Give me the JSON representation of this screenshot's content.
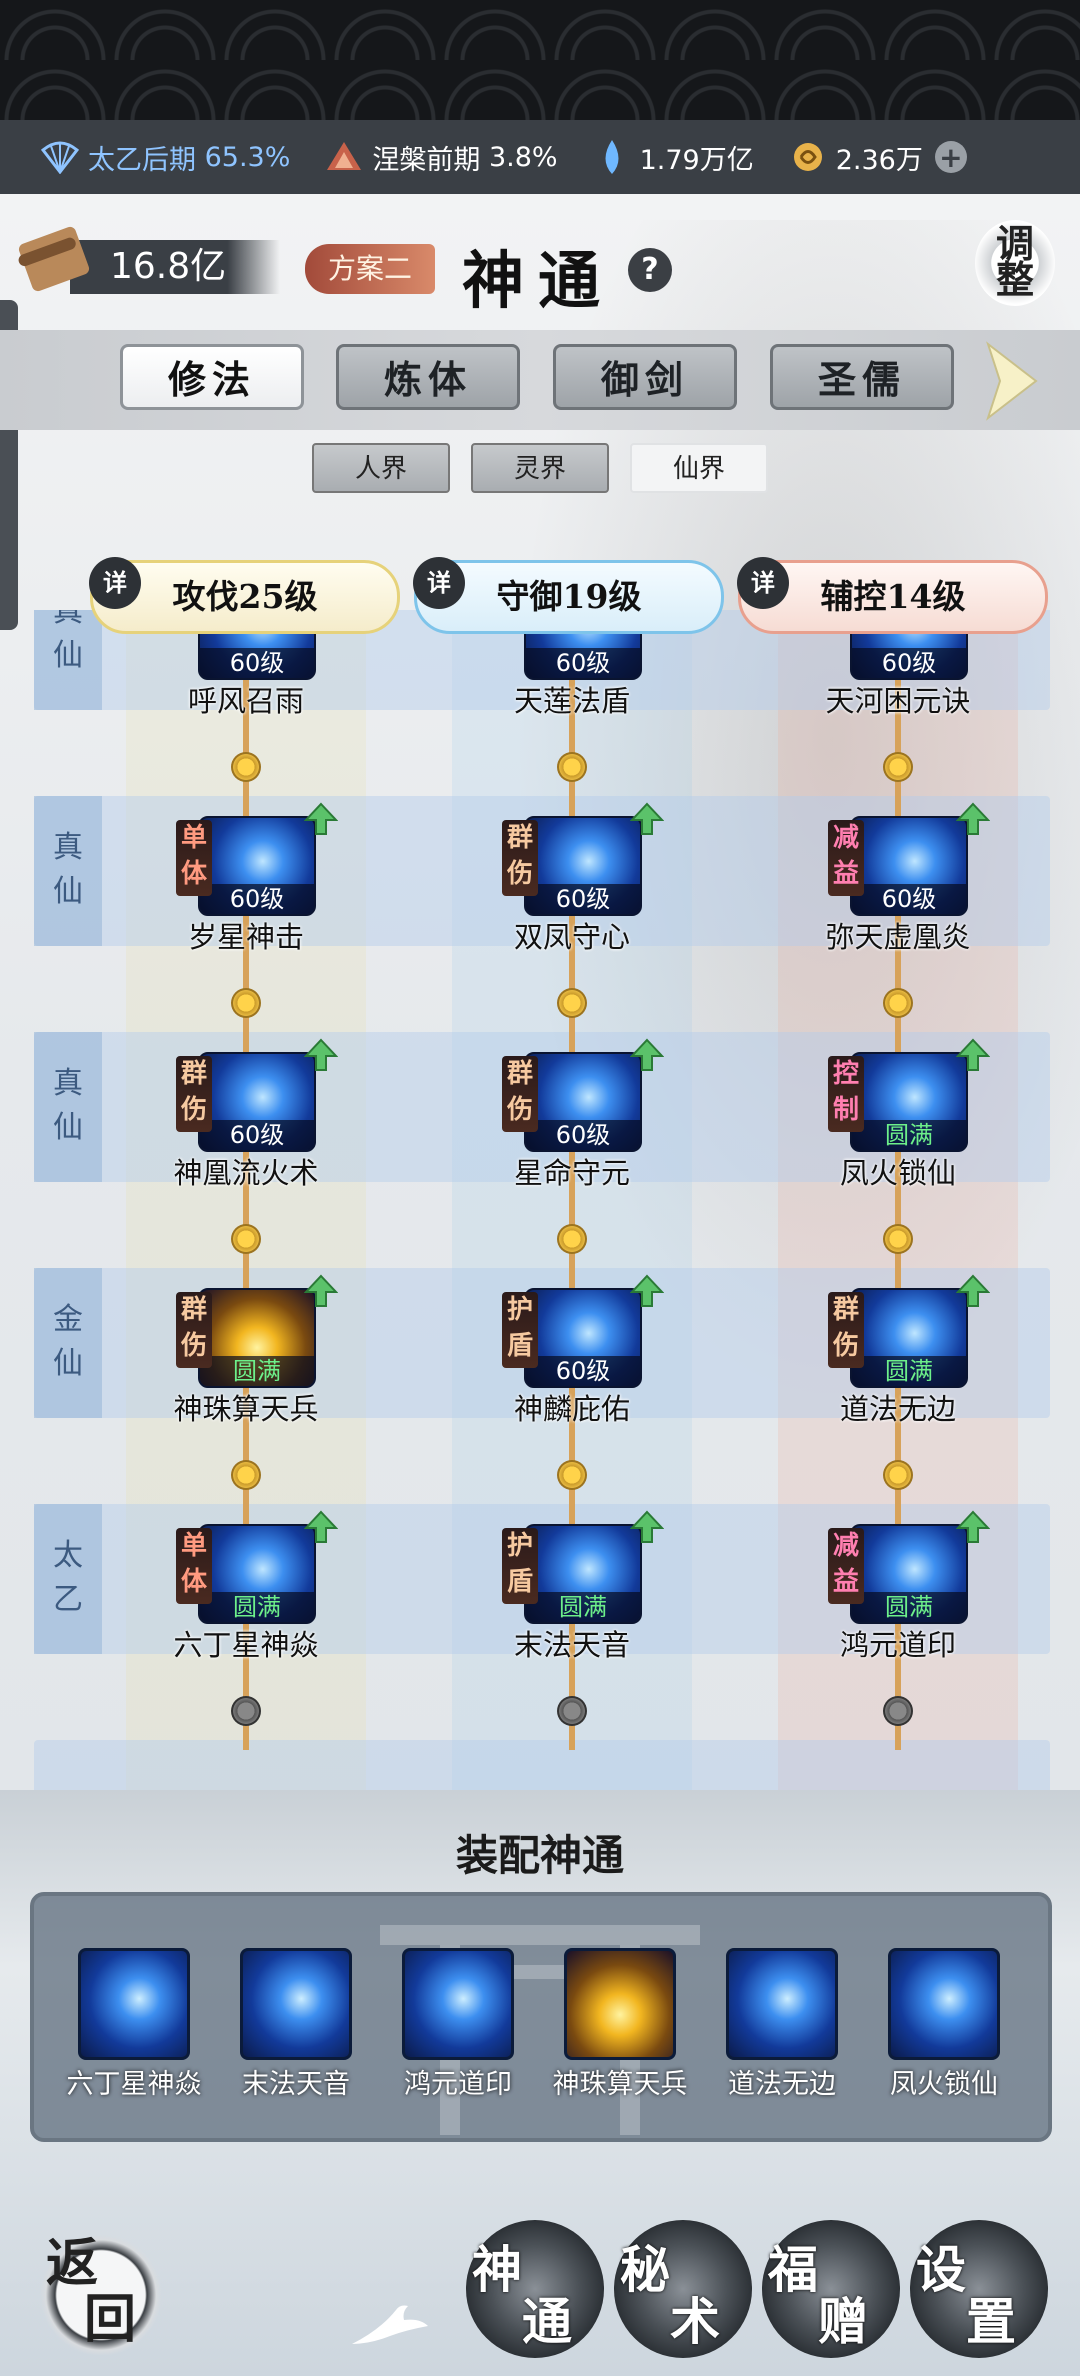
{
  "resources": [
    {
      "icon": "fan-icon",
      "label": "太乙后期",
      "value": "65.3%"
    },
    {
      "icon": "flame-icon",
      "label": "涅槃前期",
      "value": "3.8%"
    },
    {
      "icon": "spirit-drop-icon",
      "label": "",
      "value": "1.79万亿"
    },
    {
      "icon": "coin-icon",
      "label": "",
      "value": "2.36万"
    }
  ],
  "header": {
    "power": "16.8亿",
    "plan": "方案二",
    "title": "神通",
    "help": "?",
    "adjust_top": "调",
    "adjust_bottom": "整"
  },
  "tabs": [
    "修法",
    "炼体",
    "御剑",
    "圣儒"
  ],
  "active_tab": "修法",
  "realms": [
    "人界",
    "灵界",
    "仙界"
  ],
  "active_realm": "仙界",
  "categories": [
    {
      "detail": "详",
      "label": "攻伐25级",
      "color": "#e6d27a"
    },
    {
      "detail": "详",
      "label": "守御19级",
      "color": "#7ec4ea"
    },
    {
      "detail": "详",
      "label": "辅控14级",
      "color": "#e8a08e"
    }
  ],
  "rows": [
    {
      "stage": "真仙",
      "skills": [
        {
          "tag": "",
          "level": "60级",
          "name": "呼风召雨"
        },
        {
          "tag": "",
          "level": "60级",
          "name": "天莲法盾"
        },
        {
          "tag": "",
          "level": "60级",
          "name": "天河困元诀"
        }
      ]
    },
    {
      "stage": "真仙",
      "skills": [
        {
          "tag": "单体",
          "level": "60级",
          "name": "岁星神击"
        },
        {
          "tag": "群伤",
          "level": "60级",
          "name": "双凤守心"
        },
        {
          "tag": "减益",
          "level": "60级",
          "name": "弥天虚凰炎"
        }
      ]
    },
    {
      "stage": "真仙",
      "skills": [
        {
          "tag": "群伤",
          "level": "60级",
          "name": "神凰流火术"
        },
        {
          "tag": "群伤",
          "level": "60级",
          "name": "星命守元"
        },
        {
          "tag": "控制",
          "level": "圆满",
          "name": "凤火锁仙"
        }
      ]
    },
    {
      "stage": "金仙",
      "skills": [
        {
          "tag": "群伤",
          "level": "圆满",
          "name": "神珠算天兵"
        },
        {
          "tag": "护盾",
          "level": "60级",
          "name": "神麟庇佑"
        },
        {
          "tag": "群伤",
          "level": "圆满",
          "name": "道法无边"
        }
      ]
    },
    {
      "stage": "太乙",
      "skills": [
        {
          "tag": "单体",
          "level": "圆满",
          "name": "六丁星神焱"
        },
        {
          "tag": "护盾",
          "level": "圆满",
          "name": "末法天音"
        },
        {
          "tag": "减益",
          "level": "圆满",
          "name": "鸿元道印"
        }
      ]
    }
  ],
  "equip": {
    "title": "装配神通",
    "items": [
      "六丁星神焱",
      "末法天音",
      "鸿元道印",
      "神珠算天兵",
      "道法无边",
      "凤火锁仙"
    ]
  },
  "bottom_nav": {
    "back": [
      "返",
      "回"
    ],
    "buttons": [
      {
        "a": "神",
        "b": "通"
      },
      {
        "a": "秘",
        "b": "术"
      },
      {
        "a": "福",
        "b": "赠"
      },
      {
        "a": "设",
        "b": "置"
      }
    ]
  }
}
